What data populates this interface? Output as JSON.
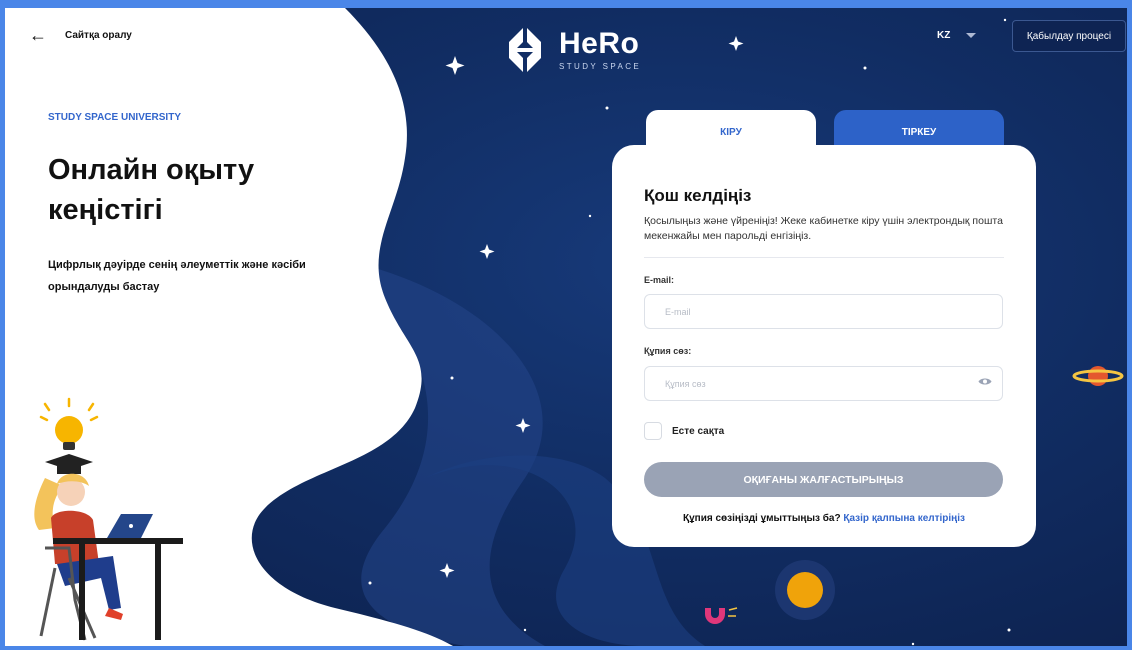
{
  "header": {
    "back_label": "Сайтқа оралу",
    "logo_name": "HeRo",
    "logo_sub": "STUDY SPACE",
    "language": "KZ",
    "admission_label": "Қабылдау процесі"
  },
  "hero": {
    "university": "STUDY SPACE UNIVERSITY",
    "title": "Онлайн оқыту кеңістігі",
    "subtitle": "Цифрлық дәуірде сенің әлеуметтік және кәсіби орындалуды бастау"
  },
  "tabs": {
    "login": "КІРУ",
    "register": "ТІРКЕУ"
  },
  "form": {
    "title": "Қош келдіңіз",
    "description": "Қосылыңыз және үйреніңіз! Жеке кабинетке кіру үшін электрондық пошта мекенжайы мен парольді енгізіңіз.",
    "email_label": "E-mail:",
    "email_placeholder": "E-mail",
    "password_label": "Құпия сөз:",
    "password_placeholder": "Құпия сөз",
    "remember_label": "Есте сақта",
    "submit_label": "ОҚИҒАНЫ ЖАЛҒАСТЫРЫҢЫЗ",
    "forgot_text": "Құпия сөзіңізді ұмыттыңыз ба?",
    "forgot_link": "Қазір қалпына келтіріңіз"
  },
  "colors": {
    "accent": "#3366cc",
    "space_dark": "#0e2453",
    "tab_active": "#2d62c8",
    "button_disabled": "#9aa3b5",
    "frame": "#4a86e8"
  },
  "icons": [
    "back-arrow-icon",
    "hero-logo-icon",
    "chevron-down-icon",
    "eye-icon",
    "star-icon",
    "planet-icon",
    "sun-icon",
    "magnet-icon",
    "lightbulb-icon"
  ]
}
